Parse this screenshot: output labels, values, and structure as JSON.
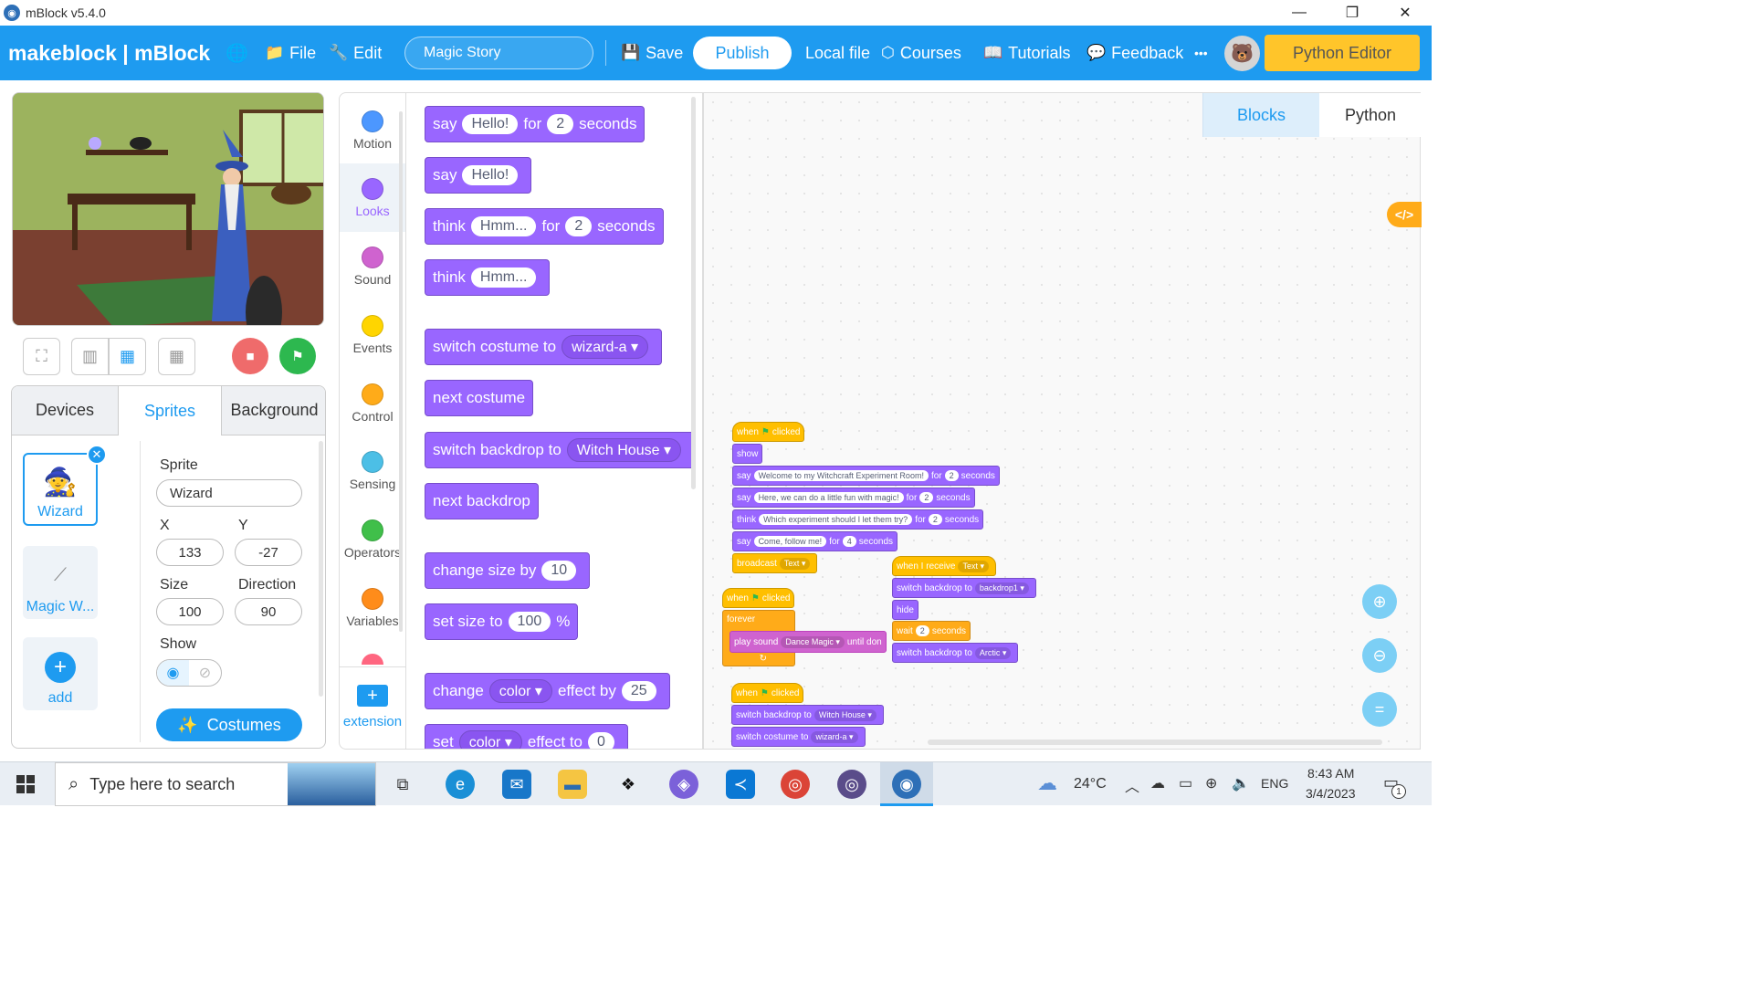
{
  "window": {
    "title": "mBlock v5.4.0"
  },
  "menu": {
    "brand": "makeblock | mBlock",
    "file": "File",
    "edit": "Edit",
    "project_name": "Magic Story",
    "save": "Save",
    "publish": "Publish",
    "local_file": "Local file",
    "courses": "Courses",
    "tutorials": "Tutorials",
    "feedback": "Feedback",
    "more": "•••",
    "python_editor": "Python Editor"
  },
  "left_tabs": {
    "devices": "Devices",
    "sprites": "Sprites",
    "background": "Background"
  },
  "sprites": [
    {
      "name": "Wizard",
      "selected": true
    },
    {
      "name": "Magic W...",
      "selected": false
    }
  ],
  "add_label": "add",
  "sprite_props": {
    "sprite_label": "Sprite",
    "sprite_value": "Wizard",
    "x_label": "X",
    "x_value": "133",
    "y_label": "Y",
    "y_value": "-27",
    "size_label": "Size",
    "size_value": "100",
    "direction_label": "Direction",
    "direction_value": "90",
    "show_label": "Show",
    "costumes_button": "Costumes"
  },
  "categories": [
    {
      "label": "Motion",
      "color": "#4c97ff"
    },
    {
      "label": "Looks",
      "color": "#9966ff"
    },
    {
      "label": "Sound",
      "color": "#cf63cf"
    },
    {
      "label": "Events",
      "color": "#ffd500"
    },
    {
      "label": "Control",
      "color": "#ffab19"
    },
    {
      "label": "Sensing",
      "color": "#4cbfe6"
    },
    {
      "label": "Operators",
      "color": "#40bf4a"
    },
    {
      "label": "Variables",
      "color": "#ff8c1a"
    }
  ],
  "extension_label": "extension",
  "palette": {
    "b1": {
      "t1": "say",
      "a1": "Hello!",
      "t2": "for",
      "a2": "2",
      "t3": "seconds"
    },
    "b2": {
      "t1": "say",
      "a1": "Hello!"
    },
    "b3": {
      "t1": "think",
      "a1": "Hmm...",
      "t2": "for",
      "a2": "2",
      "t3": "seconds"
    },
    "b4": {
      "t1": "think",
      "a1": "Hmm..."
    },
    "b5": {
      "t1": "switch costume to",
      "d1": "wizard-a ▾"
    },
    "b6": {
      "t1": "next costume"
    },
    "b7": {
      "t1": "switch backdrop to",
      "d1": "Witch House ▾"
    },
    "b8": {
      "t1": "next backdrop"
    },
    "b9": {
      "t1": "change size by",
      "a1": "10"
    },
    "b10": {
      "t1": "set size to",
      "a1": "100",
      "t2": "%"
    },
    "b11": {
      "t1": "change",
      "d1": "color ▾",
      "t2": "effect by",
      "a1": "25"
    },
    "b12": {
      "t1": "set",
      "d1": "color ▾",
      "t2": "effect to",
      "a1": "0"
    }
  },
  "code_tabs": {
    "blocks": "Blocks",
    "python": "Python"
  },
  "script1": {
    "hat": {
      "t1": "when",
      "t2": "clicked"
    },
    "show": "show",
    "say1": {
      "t1": "say",
      "a1": "Welcome to my Witchcraft Experiment Room!",
      "t2": "for",
      "a2": "2",
      "t3": "seconds"
    },
    "say2": {
      "t1": "say",
      "a1": "Here, we can do a little fun with magic!",
      "t2": "for",
      "a2": "2",
      "t3": "seconds"
    },
    "think": {
      "t1": "think",
      "a1": "Which experiment should I let them try?",
      "t2": "for",
      "a2": "2",
      "t3": "seconds"
    },
    "say3": {
      "t1": "say",
      "a1": "Come, follow me!",
      "t2": "for",
      "a2": "4",
      "t3": "seconds"
    },
    "broadcast": {
      "t1": "broadcast",
      "d1": "Text ▾"
    }
  },
  "script2": {
    "hat": {
      "t1": "when I receive",
      "d1": "Text ▾"
    },
    "sb1": {
      "t1": "switch backdrop to",
      "d1": "backdrop1 ▾"
    },
    "hide": "hide",
    "wait": {
      "t1": "wait",
      "a1": "2",
      "t2": "seconds"
    },
    "sb2": {
      "t1": "switch backdrop to",
      "d1": "Arctic ▾"
    }
  },
  "script3": {
    "hat": {
      "t1": "when",
      "t2": "clicked"
    },
    "forever": "forever",
    "play": {
      "t1": "play sound",
      "d1": "Dance Magic ▾",
      "t2": "until don"
    }
  },
  "script4": {
    "hat": {
      "t1": "when",
      "t2": "clicked"
    },
    "sb": {
      "t1": "switch backdrop to",
      "d1": "Witch House ▾"
    },
    "sc": {
      "t1": "switch costume to",
      "d1": "wizard-a ▾"
    }
  },
  "taskbar": {
    "search_placeholder": "Type here to search",
    "weather": "24°C",
    "language": "ENG",
    "time": "8:43 AM",
    "date": "3/4/2023",
    "notifications": "1"
  }
}
